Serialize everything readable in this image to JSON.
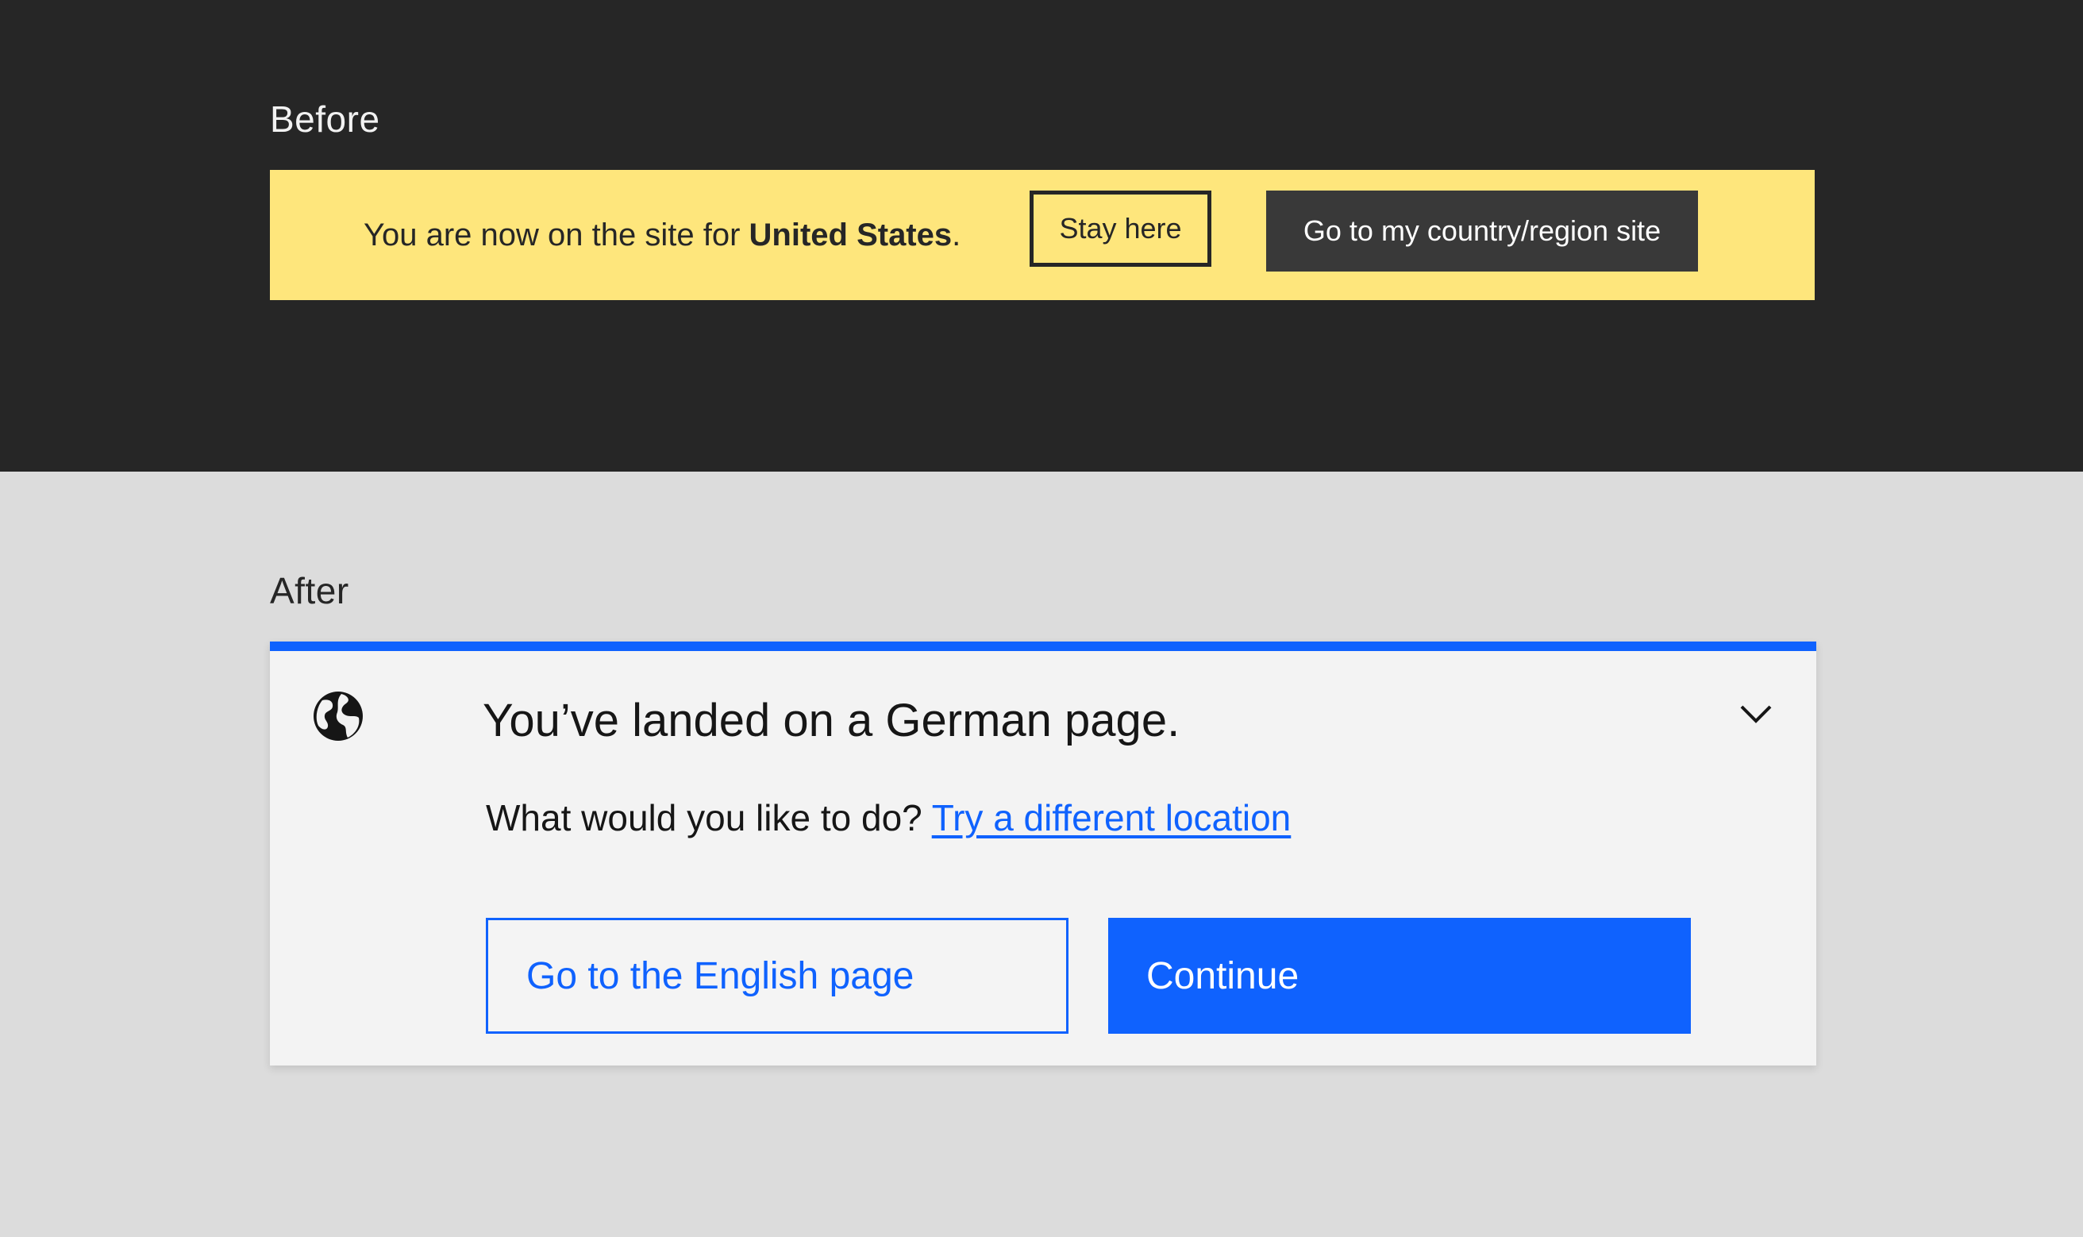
{
  "before": {
    "label": "Before",
    "banner": {
      "message_prefix": "You are now on the site for ",
      "country": "United States",
      "message_suffix": ".",
      "stay_label": "Stay here",
      "go_label": "Go to my country/region site",
      "background_color": "#fee67c"
    }
  },
  "after": {
    "label": "After",
    "notification": {
      "icon": "globe-icon",
      "title": "You’ve landed on a German page.",
      "body_prefix": "What would you like to do? ",
      "link_label": "Try a different location",
      "secondary_button": "Go to the English page",
      "primary_button": "Continue",
      "collapse_icon": "chevron-down-icon",
      "accent_color": "#0f62fe"
    }
  }
}
